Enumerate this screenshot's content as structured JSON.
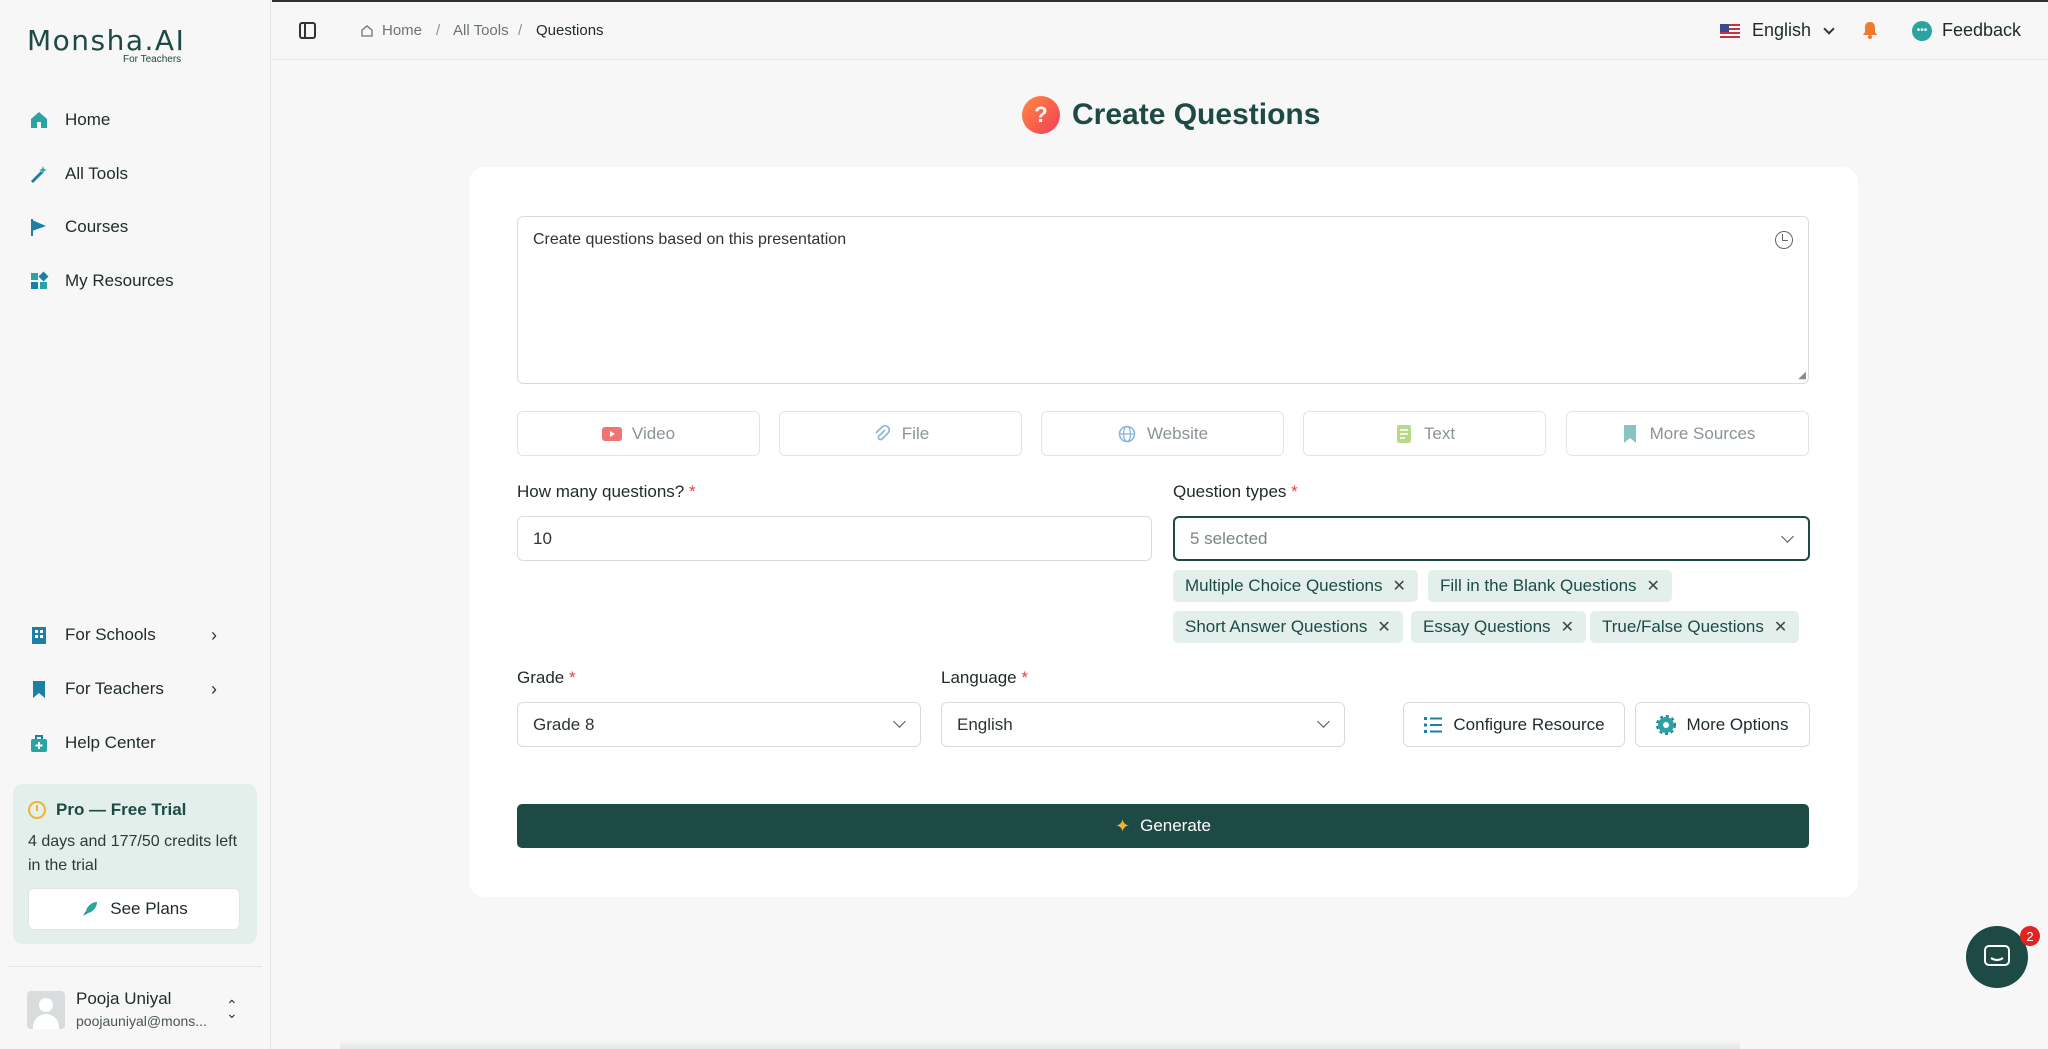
{
  "sidebar": {
    "logo": "Monsha.AI",
    "logo_sub": "For Teachers",
    "nav": [
      {
        "label": "Home",
        "icon": "home-icon"
      },
      {
        "label": "All Tools",
        "icon": "magic-wand-icon"
      },
      {
        "label": "Courses",
        "icon": "flag-icon"
      },
      {
        "label": "My Resources",
        "icon": "resources-icon"
      }
    ],
    "bottom_nav": [
      {
        "label": "For Schools",
        "icon": "building-icon"
      },
      {
        "label": "For Teachers",
        "icon": "bookmark-icon"
      },
      {
        "label": "Help Center",
        "icon": "help-icon"
      }
    ],
    "trial": {
      "title": "Pro — Free Trial",
      "text": "4 days and 177/50 credits left in the trial",
      "button": "See Plans"
    },
    "user": {
      "name": "Pooja Uniyal",
      "email": "poojauniyal@mons..."
    }
  },
  "topbar": {
    "breadcrumb": [
      "Home",
      "All Tools",
      "Questions"
    ],
    "language": "English",
    "feedback": "Feedback"
  },
  "page": {
    "title": "Create Questions",
    "prompt_value": "Create questions based on this presentation",
    "sources": [
      "Video",
      "File",
      "Website",
      "Text",
      "More Sources"
    ],
    "count_label": "How many questions?",
    "count_value": "10",
    "types_label": "Question types",
    "types_value": "5 selected",
    "chips": [
      "Multiple Choice Questions",
      "Fill in the Blank Questions",
      "Short Answer Questions",
      "Essay Questions",
      "True/False Questions"
    ],
    "grade_label": "Grade",
    "grade_value": "Grade 8",
    "language_label": "Language",
    "language_value": "English",
    "configure_button": "Configure Resource",
    "more_options_button": "More Options",
    "generate_button": "Generate"
  },
  "chat_badge": "2",
  "colors": {
    "brand": "#1e4a45",
    "accent_teal": "#2aa3a1",
    "chip_bg": "#e3efeb",
    "required": "#e0453a"
  }
}
